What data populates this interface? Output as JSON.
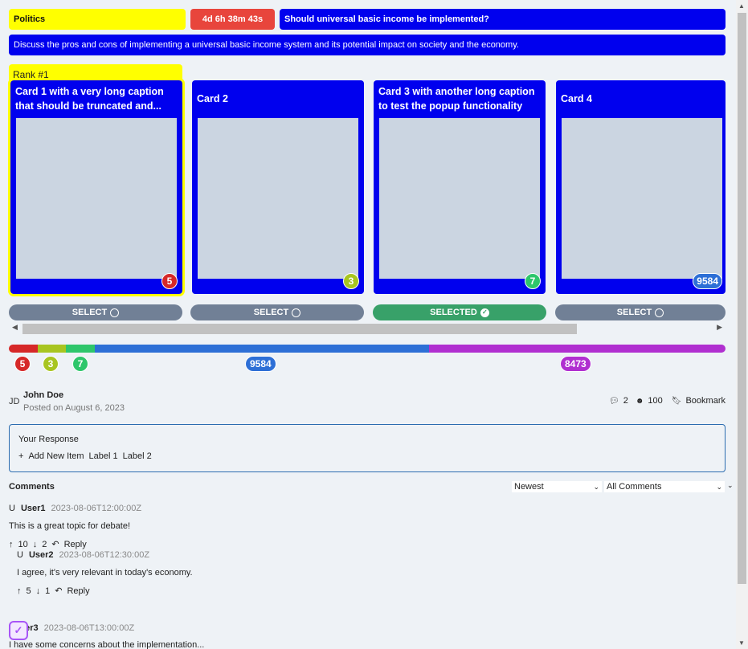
{
  "header": {
    "category": "Politics",
    "timer": "4d 6h 38m 43s",
    "question": "Should universal basic income be implemented?",
    "description": "Discuss the pros and cons of implementing a universal basic income system and its potential impact on society and the economy.",
    "rank_label": "Rank #1"
  },
  "cards": [
    {
      "title": "Card 1 with a very long caption that should be truncated and...",
      "count": "5",
      "badge_color": "#d62828",
      "button": "SELECT"
    },
    {
      "title": "Card 2",
      "count": "3",
      "badge_color": "#a8c520",
      "button": "SELECT"
    },
    {
      "title": "Card 3 with another long caption to test the popup functionality",
      "count": "7",
      "badge_color": "#2ec66b",
      "button": "SELECTED"
    },
    {
      "title": "Card 4",
      "count": "9584",
      "badge_color": "#2d6fd6",
      "button": "SELECT"
    }
  ],
  "distribution": [
    {
      "value": "5",
      "color": "#d62828"
    },
    {
      "value": "3",
      "color": "#a8c520"
    },
    {
      "value": "7",
      "color": "#2ec66b"
    },
    {
      "value": "9584",
      "color": "#2d6fd6"
    },
    {
      "value": "8473",
      "color": "#b02fd0"
    }
  ],
  "post": {
    "initials": "JD",
    "author": "John Doe",
    "date": "Posted on August 6, 2023",
    "comment_count": "2",
    "reactions": "100",
    "bookmark": "Bookmark"
  },
  "response": {
    "title": "Your Response",
    "add_item": "Add New Item",
    "label1": "Label 1",
    "label2": "Label 2"
  },
  "comments": {
    "title": "Comments",
    "sort": "Newest",
    "filter": "All Comments",
    "items": [
      {
        "initial": "U",
        "user": "User1",
        "time": "2023-08-06T12:00:00Z",
        "text": "This is a great topic for debate!",
        "up": "10",
        "down": "2",
        "reply": "Reply"
      },
      {
        "initial": "U",
        "user": "User2",
        "time": "2023-08-06T12:30:00Z",
        "text": "I agree, it's very relevant in today's economy.",
        "up": "5",
        "down": "1",
        "reply": "Reply"
      },
      {
        "initial": "",
        "user": "ser3",
        "time": "2023-08-06T13:00:00Z",
        "text": "I have some concerns about the implementation..."
      }
    ]
  }
}
